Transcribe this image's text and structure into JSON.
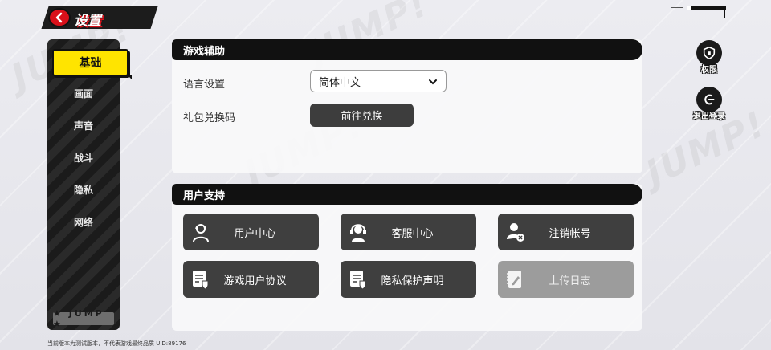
{
  "header": {
    "title": "设置"
  },
  "sidebar": {
    "items": [
      {
        "label": "基础",
        "active": true
      },
      {
        "label": "画面",
        "active": false
      },
      {
        "label": "声音",
        "active": false
      },
      {
        "label": "战斗",
        "active": false
      },
      {
        "label": "隐私",
        "active": false
      },
      {
        "label": "网络",
        "active": false
      }
    ],
    "badge": "★ JUMP ★"
  },
  "assist": {
    "title": "游戏辅助",
    "language_label": "语言设置",
    "language_value": "简体中文",
    "gift_label": "礼包兑换码",
    "gift_button": "前往兑换"
  },
  "support": {
    "title": "用户支持",
    "buttons": [
      {
        "label": "用户中心",
        "icon": "user-headset-icon",
        "enabled": true
      },
      {
        "label": "客服中心",
        "icon": "headset-icon",
        "enabled": true
      },
      {
        "label": "注销帐号",
        "icon": "user-remove-icon",
        "enabled": true
      },
      {
        "label": "游戏用户协议",
        "icon": "document-shield-icon",
        "enabled": true
      },
      {
        "label": "隐私保护声明",
        "icon": "document-shield-icon",
        "enabled": true
      },
      {
        "label": "上传日志",
        "icon": "notebook-pen-icon",
        "enabled": false
      }
    ]
  },
  "right_actions": {
    "permissions": "权限",
    "logout": "退出登录"
  },
  "footer": "当前版本为测试版本，不代表游戏最终品质 UID:89176",
  "colors": {
    "accent": "#ffe400",
    "brand_red": "#d9101a",
    "dark": "#111111"
  }
}
